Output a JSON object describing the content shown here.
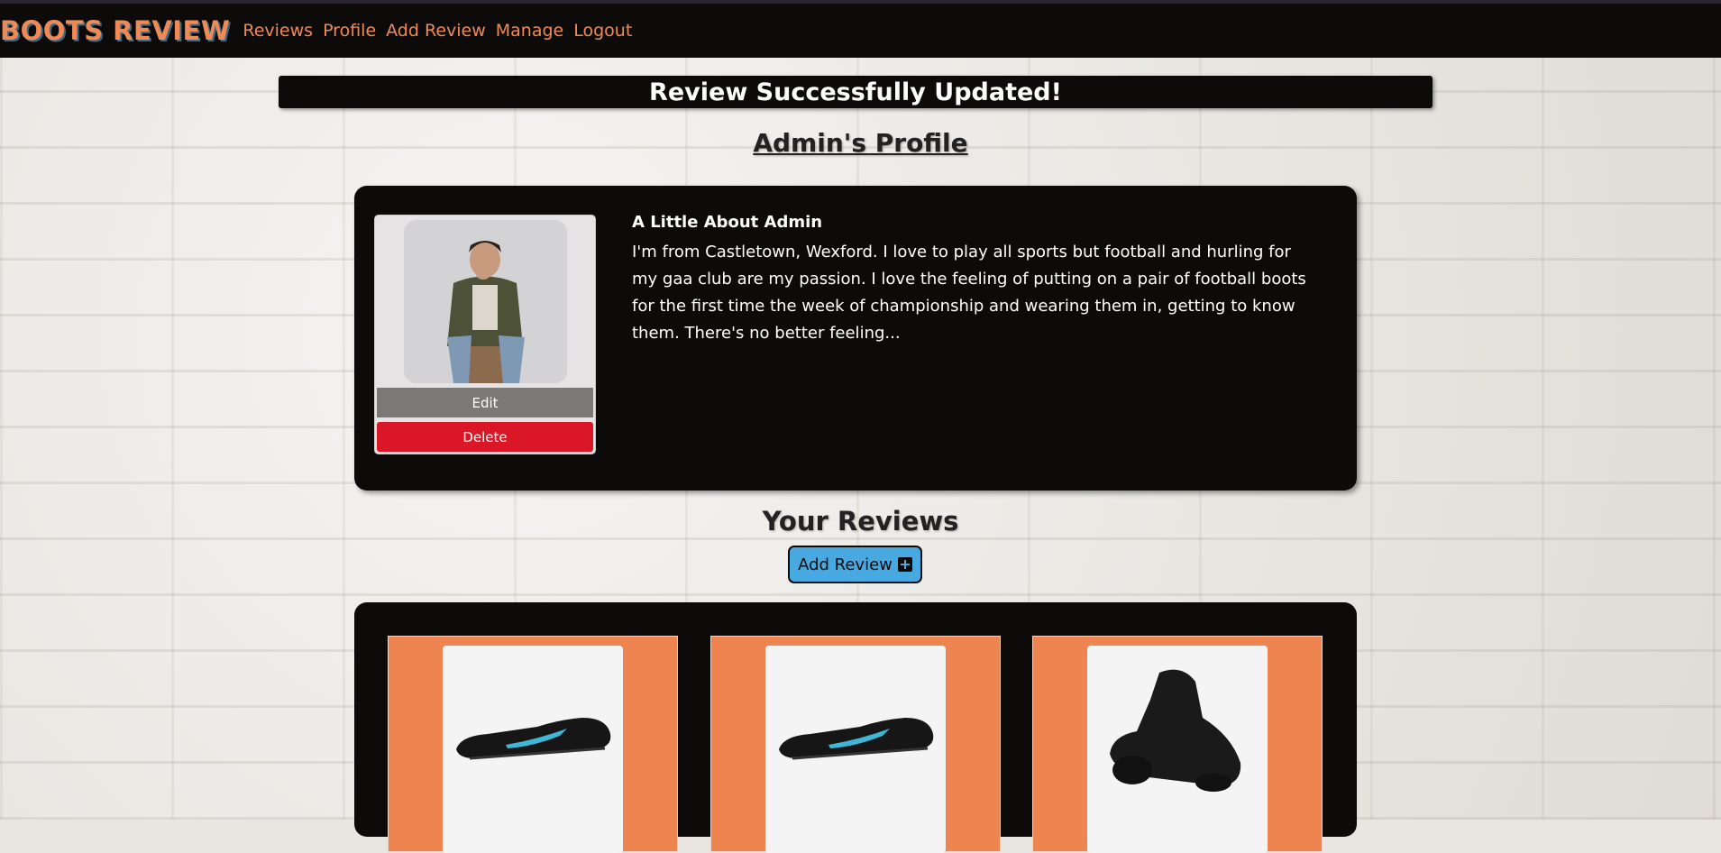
{
  "nav": {
    "brand": "BOOTS REVIEW",
    "links": [
      "Reviews",
      "Profile",
      "Add Review",
      "Manage",
      "Logout"
    ]
  },
  "alert": {
    "message": "Review Successfully Updated!"
  },
  "profile": {
    "title": "Admin's Profile",
    "about_heading": "A Little About Admin",
    "about_text": "I'm from Castletown, Wexford. I love to play all sports but football and hurling for my gaa club are my passion. I love the feeling of putting on a pair of football boots for the first time the week of championship and wearing them in, getting to know them. There's no better feeling...",
    "edit_label": "Edit",
    "delete_label": "Delete"
  },
  "reviews": {
    "title": "Your Reviews",
    "add_label": "Add Review",
    "add_icon": "plus-square-icon",
    "cards": [
      {
        "image": "boot-low-black-blue-swoosh"
      },
      {
        "image": "boot-low-black-blue-swoosh"
      },
      {
        "image": "boot-high-black"
      }
    ]
  },
  "colors": {
    "accent": "#ee8a55",
    "navbar": "#0d0b0a",
    "delete": "#db1626",
    "edit": "#7b7977",
    "add_button": "#48a9e0",
    "card": "#ee8450"
  }
}
